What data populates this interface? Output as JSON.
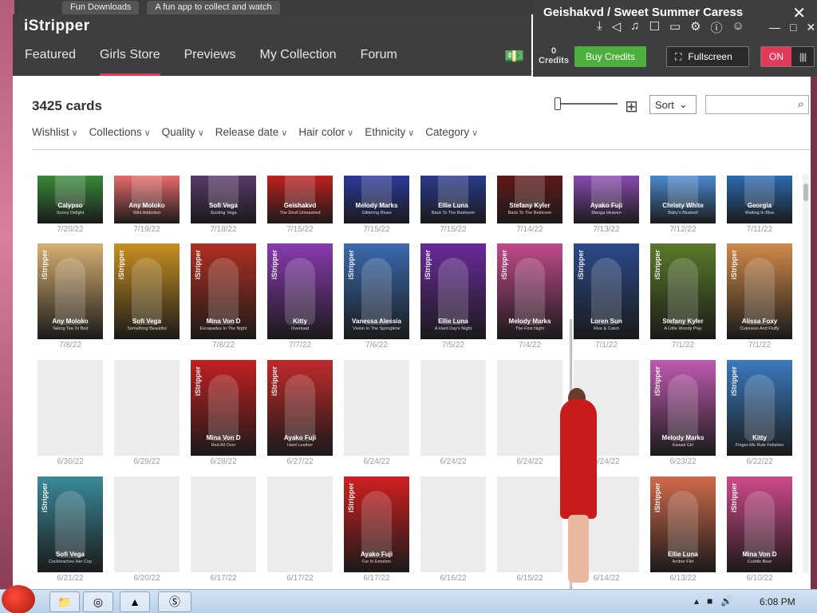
{
  "browser": {
    "tab1": "Fun Downloads",
    "tab2": "A fun app to collect and watch"
  },
  "app": {
    "logo": "iStripper",
    "nav": [
      "Featured",
      "Girls Store",
      "Previews",
      "My Collection",
      "Forum"
    ],
    "active_nav": "Girls Store"
  },
  "player": {
    "title": "Geishakvd / Sweet Summer Caress",
    "credits_value": "0",
    "credits_label": "Credits",
    "buy_label": "Buy Credits",
    "fullscreen_label": "Fullscreen",
    "toggle_label": "ON"
  },
  "toolbar": {
    "count": "3425 cards",
    "sort_label": "Sort",
    "search_placeholder": ""
  },
  "filters": [
    "Wishlist",
    "Collections",
    "Quality",
    "Release date",
    "Hair color",
    "Ethnicity",
    "Category"
  ],
  "cards": {
    "row1": [
      {
        "name": "Calypso",
        "sub": "Sunny Delight",
        "date": "7/20/22",
        "color": "#3a8a3a"
      },
      {
        "name": "Any Moloko",
        "sub": "Wild Addiction",
        "date": "7/19/22",
        "color": "#e86a6a"
      },
      {
        "name": "Sofi Vega",
        "sub": "Sizzling Vega",
        "date": "7/18/22",
        "color": "#5a3a6a"
      },
      {
        "name": "Geishakvd",
        "sub": "The Devil Unleashed",
        "date": "7/15/22",
        "color": "#c02020"
      },
      {
        "name": "Melody Marks",
        "sub": "Glittering Blues",
        "date": "7/15/22",
        "color": "#2a3a9a"
      },
      {
        "name": "Ellie Luna",
        "sub": "Back To The Bedroom",
        "date": "7/15/22",
        "color": "#2a3a8a"
      },
      {
        "name": "Stefany Kyler",
        "sub": "Back To The Bedroom",
        "date": "7/14/22",
        "color": "#601818"
      },
      {
        "name": "Ayako Fuji",
        "sub": "Manga Heaven",
        "date": "7/13/22",
        "color": "#8a4ab0"
      },
      {
        "name": "Christy White",
        "sub": "Baby's Bluebell",
        "date": "7/12/22",
        "color": "#4a8ad0"
      },
      {
        "name": "Georgia",
        "sub": "Waiting In Blue",
        "date": "7/11/22",
        "color": "#2a6ab0"
      }
    ],
    "row2": [
      {
        "name": "Any Moloko",
        "sub": "Taking Tea To Bed",
        "date": "7/8/22",
        "color": "#d8b070"
      },
      {
        "name": "Sofi Vega",
        "sub": "Something Beautiful",
        "date": "",
        "color": "#c89020"
      },
      {
        "name": "Mina Von D",
        "sub": "Escapades In The Night",
        "date": "7/8/22",
        "color": "#b03020"
      },
      {
        "name": "Kitty",
        "sub": "Overload",
        "date": "7/7/22",
        "color": "#8a3ab0"
      },
      {
        "name": "Vanessa Alessia",
        "sub": "Vision In The Springtime",
        "date": "7/6/22",
        "color": "#3a6ab0"
      },
      {
        "name": "Ellie Luna",
        "sub": "A Hard Day's Night",
        "date": "7/5/22",
        "color": "#6a2a9a"
      },
      {
        "name": "Melody Marks",
        "sub": "The First Night",
        "date": "7/4/22",
        "color": "#c04a8a"
      },
      {
        "name": "Loren Sun",
        "sub": "Rise & Catch",
        "date": "7/1/22",
        "color": "#2a4a8a"
      },
      {
        "name": "Stefany Kyler",
        "sub": "A Little Woody Play",
        "date": "7/1/22",
        "color": "#5a7a2a"
      },
      {
        "name": "Alissa Foxy",
        "sub": "Cuteness And Fluffy",
        "date": "7/1/22",
        "color": "#d08a4a"
      }
    ],
    "row3": [
      {
        "name": "",
        "sub": "",
        "date": "6/30/22",
        "color": ""
      },
      {
        "name": "",
        "sub": "",
        "date": "6/29/22",
        "color": ""
      },
      {
        "name": "Mina Von D",
        "sub": "Red All Over",
        "date": "6/28/22",
        "color": "#c02020"
      },
      {
        "name": "Ayako Fuji",
        "sub": "Hard Leather",
        "date": "6/27/22",
        "color": "#c02a2a"
      },
      {
        "name": "",
        "sub": "",
        "date": "6/24/22",
        "color": ""
      },
      {
        "name": "",
        "sub": "",
        "date": "6/24/22",
        "color": ""
      },
      {
        "name": "",
        "sub": "",
        "date": "6/24/22",
        "color": ""
      },
      {
        "name": "",
        "sub": "",
        "date": "6/24/22",
        "color": ""
      },
      {
        "name": "Melody Marks",
        "sub": "Kawaii Girl",
        "date": "6/23/22",
        "color": "#c05ab0"
      },
      {
        "name": "Kitty",
        "sub": "Finger-Me Rule Fetishes",
        "date": "6/22/22",
        "color": "#3a7ac0"
      }
    ],
    "row4": [
      {
        "name": "Sofi Vega",
        "sub": "Cockroaches Her Cop",
        "date": "6/21/22",
        "color": "#3a8a9a"
      },
      {
        "name": "",
        "sub": "",
        "date": "6/20/22",
        "color": ""
      },
      {
        "name": "",
        "sub": "",
        "date": "6/17/22",
        "color": ""
      },
      {
        "name": "",
        "sub": "",
        "date": "6/17/22",
        "color": ""
      },
      {
        "name": "Ayako Fuji",
        "sub": "Fur In Emotion",
        "date": "6/17/22",
        "color": "#d02020"
      },
      {
        "name": "",
        "sub": "",
        "date": "6/16/22",
        "color": ""
      },
      {
        "name": "",
        "sub": "",
        "date": "6/15/22",
        "color": ""
      },
      {
        "name": "",
        "sub": "",
        "date": "6/14/22",
        "color": ""
      },
      {
        "name": "Ellie Luna",
        "sub": "Amber Flirt",
        "date": "6/13/22",
        "color": "#d06a4a"
      },
      {
        "name": "Mina Von D",
        "sub": "Cuddle Bear",
        "date": "6/10/22",
        "color": "#d04a8a"
      }
    ]
  },
  "taskbar": {
    "clock": "6:08 PM"
  },
  "colors": {
    "accent": "#e33a5a",
    "buy": "#4caf3e",
    "header": "#3e3e40"
  }
}
